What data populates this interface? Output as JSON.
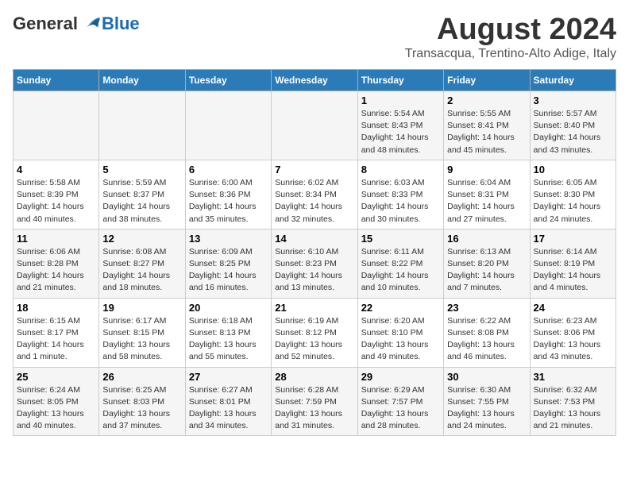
{
  "logo": {
    "general": "General",
    "blue": "Blue"
  },
  "title": {
    "month_year": "August 2024",
    "location": "Transacqua, Trentino-Alto Adige, Italy"
  },
  "days_of_week": [
    "Sunday",
    "Monday",
    "Tuesday",
    "Wednesday",
    "Thursday",
    "Friday",
    "Saturday"
  ],
  "weeks": [
    {
      "days": [
        {
          "num": "",
          "info": ""
        },
        {
          "num": "",
          "info": ""
        },
        {
          "num": "",
          "info": ""
        },
        {
          "num": "",
          "info": ""
        },
        {
          "num": "1",
          "info": "Sunrise: 5:54 AM\nSunset: 8:43 PM\nDaylight: 14 hours\nand 48 minutes."
        },
        {
          "num": "2",
          "info": "Sunrise: 5:55 AM\nSunset: 8:41 PM\nDaylight: 14 hours\nand 45 minutes."
        },
        {
          "num": "3",
          "info": "Sunrise: 5:57 AM\nSunset: 8:40 PM\nDaylight: 14 hours\nand 43 minutes."
        }
      ]
    },
    {
      "days": [
        {
          "num": "4",
          "info": "Sunrise: 5:58 AM\nSunset: 8:39 PM\nDaylight: 14 hours\nand 40 minutes."
        },
        {
          "num": "5",
          "info": "Sunrise: 5:59 AM\nSunset: 8:37 PM\nDaylight: 14 hours\nand 38 minutes."
        },
        {
          "num": "6",
          "info": "Sunrise: 6:00 AM\nSunset: 8:36 PM\nDaylight: 14 hours\nand 35 minutes."
        },
        {
          "num": "7",
          "info": "Sunrise: 6:02 AM\nSunset: 8:34 PM\nDaylight: 14 hours\nand 32 minutes."
        },
        {
          "num": "8",
          "info": "Sunrise: 6:03 AM\nSunset: 8:33 PM\nDaylight: 14 hours\nand 30 minutes."
        },
        {
          "num": "9",
          "info": "Sunrise: 6:04 AM\nSunset: 8:31 PM\nDaylight: 14 hours\nand 27 minutes."
        },
        {
          "num": "10",
          "info": "Sunrise: 6:05 AM\nSunset: 8:30 PM\nDaylight: 14 hours\nand 24 minutes."
        }
      ]
    },
    {
      "days": [
        {
          "num": "11",
          "info": "Sunrise: 6:06 AM\nSunset: 8:28 PM\nDaylight: 14 hours\nand 21 minutes."
        },
        {
          "num": "12",
          "info": "Sunrise: 6:08 AM\nSunset: 8:27 PM\nDaylight: 14 hours\nand 18 minutes."
        },
        {
          "num": "13",
          "info": "Sunrise: 6:09 AM\nSunset: 8:25 PM\nDaylight: 14 hours\nand 16 minutes."
        },
        {
          "num": "14",
          "info": "Sunrise: 6:10 AM\nSunset: 8:23 PM\nDaylight: 14 hours\nand 13 minutes."
        },
        {
          "num": "15",
          "info": "Sunrise: 6:11 AM\nSunset: 8:22 PM\nDaylight: 14 hours\nand 10 minutes."
        },
        {
          "num": "16",
          "info": "Sunrise: 6:13 AM\nSunset: 8:20 PM\nDaylight: 14 hours\nand 7 minutes."
        },
        {
          "num": "17",
          "info": "Sunrise: 6:14 AM\nSunset: 8:19 PM\nDaylight: 14 hours\nand 4 minutes."
        }
      ]
    },
    {
      "days": [
        {
          "num": "18",
          "info": "Sunrise: 6:15 AM\nSunset: 8:17 PM\nDaylight: 14 hours\nand 1 minute."
        },
        {
          "num": "19",
          "info": "Sunrise: 6:17 AM\nSunset: 8:15 PM\nDaylight: 13 hours\nand 58 minutes."
        },
        {
          "num": "20",
          "info": "Sunrise: 6:18 AM\nSunset: 8:13 PM\nDaylight: 13 hours\nand 55 minutes."
        },
        {
          "num": "21",
          "info": "Sunrise: 6:19 AM\nSunset: 8:12 PM\nDaylight: 13 hours\nand 52 minutes."
        },
        {
          "num": "22",
          "info": "Sunrise: 6:20 AM\nSunset: 8:10 PM\nDaylight: 13 hours\nand 49 minutes."
        },
        {
          "num": "23",
          "info": "Sunrise: 6:22 AM\nSunset: 8:08 PM\nDaylight: 13 hours\nand 46 minutes."
        },
        {
          "num": "24",
          "info": "Sunrise: 6:23 AM\nSunset: 8:06 PM\nDaylight: 13 hours\nand 43 minutes."
        }
      ]
    },
    {
      "days": [
        {
          "num": "25",
          "info": "Sunrise: 6:24 AM\nSunset: 8:05 PM\nDaylight: 13 hours\nand 40 minutes."
        },
        {
          "num": "26",
          "info": "Sunrise: 6:25 AM\nSunset: 8:03 PM\nDaylight: 13 hours\nand 37 minutes."
        },
        {
          "num": "27",
          "info": "Sunrise: 6:27 AM\nSunset: 8:01 PM\nDaylight: 13 hours\nand 34 minutes."
        },
        {
          "num": "28",
          "info": "Sunrise: 6:28 AM\nSunset: 7:59 PM\nDaylight: 13 hours\nand 31 minutes."
        },
        {
          "num": "29",
          "info": "Sunrise: 6:29 AM\nSunset: 7:57 PM\nDaylight: 13 hours\nand 28 minutes."
        },
        {
          "num": "30",
          "info": "Sunrise: 6:30 AM\nSunset: 7:55 PM\nDaylight: 13 hours\nand 24 minutes."
        },
        {
          "num": "31",
          "info": "Sunrise: 6:32 AM\nSunset: 7:53 PM\nDaylight: 13 hours\nand 21 minutes."
        }
      ]
    }
  ]
}
